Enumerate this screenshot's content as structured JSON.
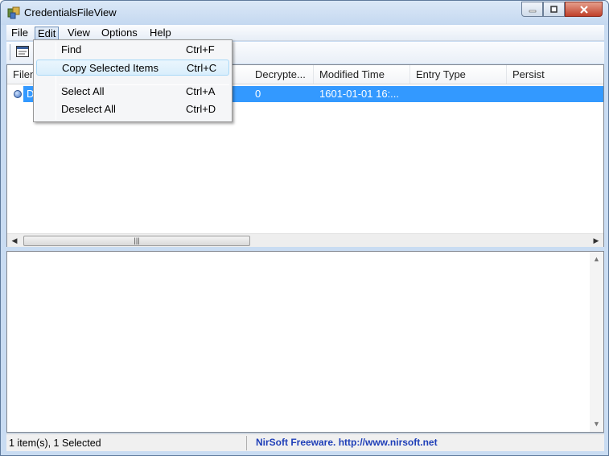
{
  "window": {
    "title": "CredentialsFileView"
  },
  "menubar": {
    "items": [
      {
        "label": "File"
      },
      {
        "label": "Edit"
      },
      {
        "label": "View"
      },
      {
        "label": "Options"
      },
      {
        "label": "Help"
      }
    ]
  },
  "edit_menu": {
    "items": [
      {
        "label": "Find",
        "shortcut": "Ctrl+F"
      },
      {
        "label": "Copy Selected Items",
        "shortcut": "Ctrl+C"
      },
      {
        "label": "Select All",
        "shortcut": "Ctrl+A"
      },
      {
        "label": "Deselect All",
        "shortcut": "Ctrl+D"
      }
    ]
  },
  "list": {
    "columns": [
      "Filen",
      "Decrypte...",
      "Modified Time",
      "Entry Type",
      "Persist"
    ],
    "rows": [
      {
        "col0": "D",
        "decrypted": "0",
        "modified": "1601-01-01 16:..."
      }
    ]
  },
  "status": {
    "left": "1 item(s), 1 Selected",
    "right": "NirSoft Freeware.  http://www.nirsoft.net"
  },
  "colors": {
    "selection": "#3399ff",
    "link": "#1f3fb8"
  }
}
